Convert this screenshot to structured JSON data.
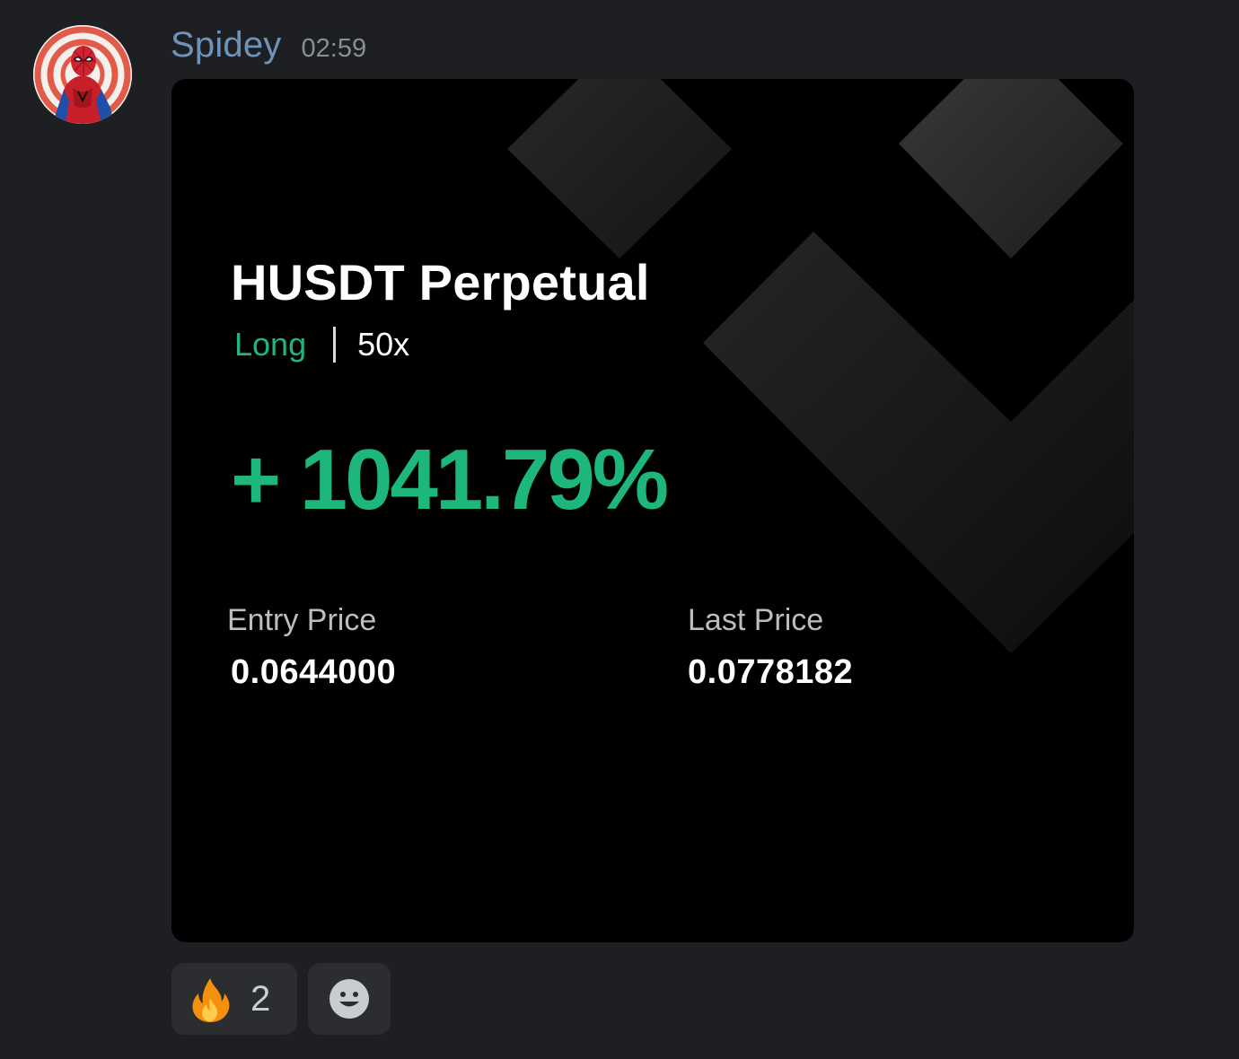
{
  "message": {
    "username": "Spidey",
    "timestamp": "02:59",
    "avatar_icon": "spiderman-avatar"
  },
  "card": {
    "title": "HUSDT Perpetual",
    "side": "Long",
    "leverage": "50x",
    "roi": "+ 1041.79%",
    "entry_label": "Entry Price",
    "entry_value": "0.0644000",
    "last_label": "Last Price",
    "last_value": "0.0778182",
    "accent_color": "#1db77b"
  },
  "reactions": [
    {
      "icon": "fire-icon",
      "count": "2"
    },
    {
      "icon": "add-reaction-icon"
    }
  ]
}
